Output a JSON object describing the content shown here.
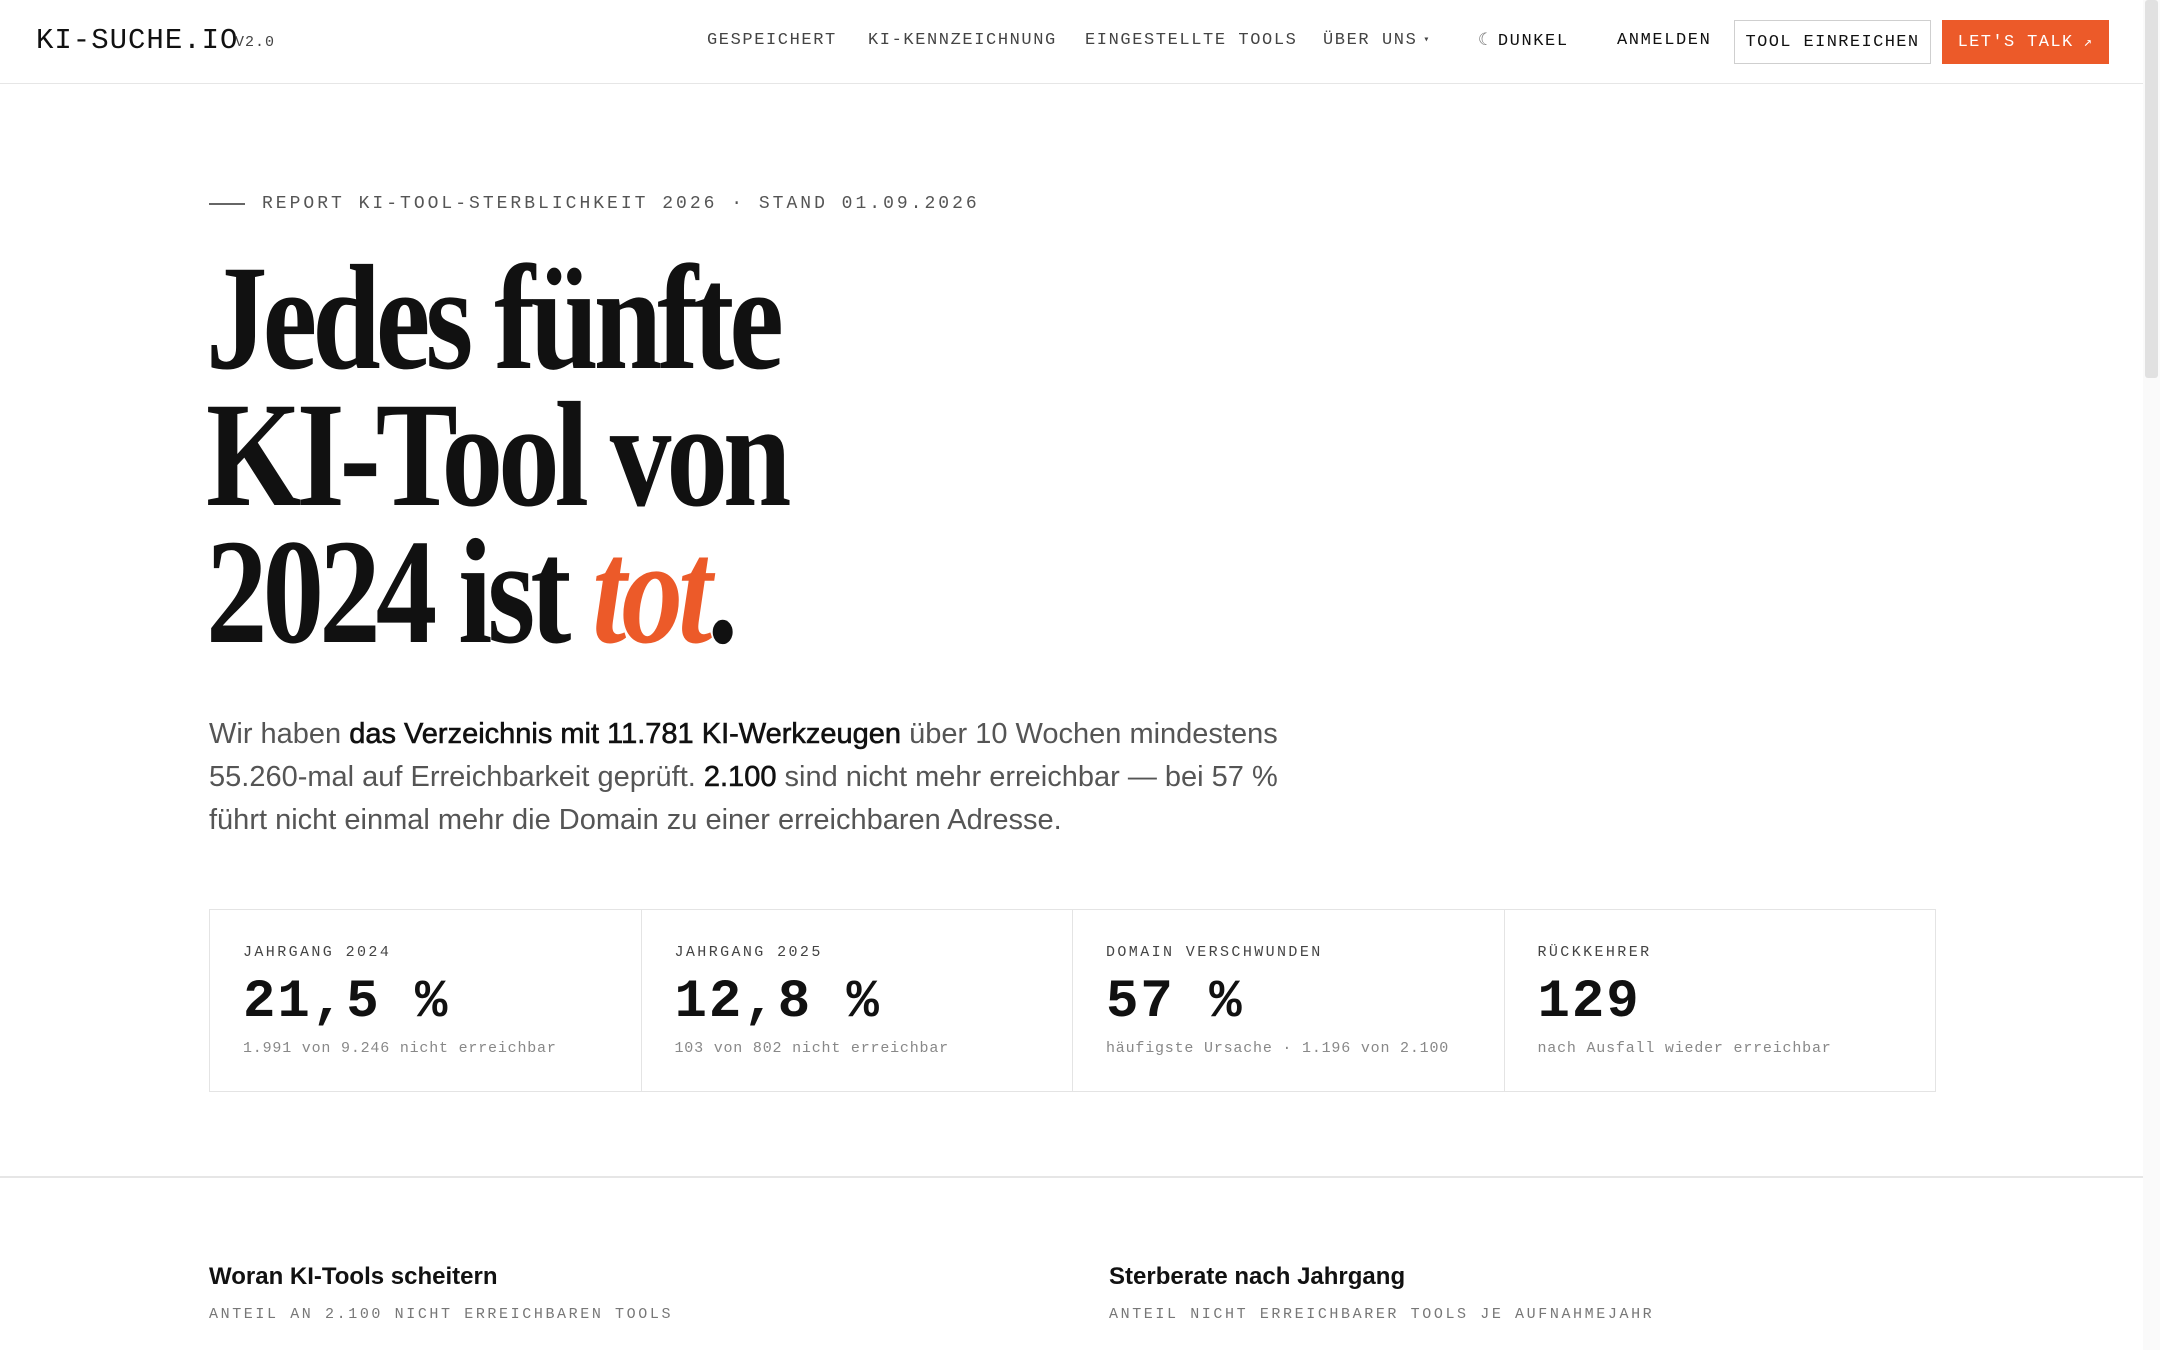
{
  "header": {
    "logo": "KI-SUCHE.IO",
    "version": "V2.0",
    "nav": {
      "saved": "GESPEICHERT",
      "ai_label": "KI-KENNZEICHNUNG",
      "discontinued": "EINGESTELLTE TOOLS",
      "about": "ÜBER UNS"
    },
    "theme_toggle": "DUNKEL",
    "login": "ANMELDEN",
    "submit_tool": "TOOL EINREICHEN",
    "cta": "LET'S TALK",
    "cta_arrow": "↗",
    "about_caret": "▾",
    "moon_glyph": "☾"
  },
  "hero": {
    "eyebrow": "REPORT KI-TOOL-STERBLICHKEIT 2026 · STAND 01.09.2026",
    "headline_line1": "Jedes fünfte",
    "headline_line2": "KI-Tool von",
    "headline_line3_pre": "2024 ist ",
    "headline_line3_accent": "tot",
    "headline_line3_post": ".",
    "lead": {
      "p1": "Wir haben ",
      "b1": "das Verzeichnis mit 11.781 KI-Werkzeugen",
      "p2": " über 10 Wochen mindestens 55.260-mal auf Erreichbarkeit geprüft. ",
      "b2": "2.100",
      "p3": " sind nicht mehr erreichbar — bei 57 % führt nicht einmal mehr die Domain zu einer erreichbaren Adresse."
    }
  },
  "stats": [
    {
      "label": "JAHRGANG 2024",
      "value": "21,5 %",
      "sub": "1.991 von 9.246 nicht erreichbar"
    },
    {
      "label": "JAHRGANG 2025",
      "value": "12,8 %",
      "sub": "103 von 802 nicht erreichbar"
    },
    {
      "label": "DOMAIN VERSCHWUNDEN",
      "value": "57 %",
      "sub": "häufigste Ursache · 1.196 von 2.100"
    },
    {
      "label": "RÜCKKEHRER",
      "value": "129",
      "sub": "nach Ausfall wieder erreichbar"
    }
  ],
  "sections": {
    "causes_title": "Woran KI-Tools scheitern",
    "causes_sub": "ANTEIL AN 2.100 NICHT ERREICHBAREN TOOLS",
    "rate_title": "Sterberate nach Jahrgang",
    "rate_sub": "ANTEIL NICHT ERREICHBARER TOOLS JE AUFNAHMEJAHR"
  },
  "colors": {
    "accent": "#ec5a29",
    "text": "#111111",
    "muted": "#555555",
    "border": "#e4e4e4"
  }
}
